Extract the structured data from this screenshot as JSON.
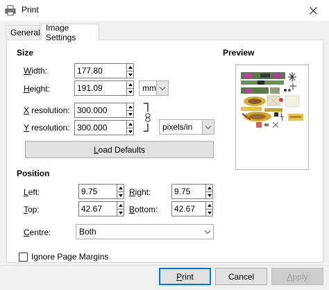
{
  "window": {
    "title": "Print",
    "icon": "printer-icon",
    "close_icon": "close-icon"
  },
  "tabs": [
    {
      "label": "General",
      "active": false
    },
    {
      "label": "Image Settings",
      "active": true
    }
  ],
  "size": {
    "heading": "Size",
    "width_label_u": "W",
    "width_label_rest": "idth:",
    "width_value": "177.80",
    "height_label_u": "H",
    "height_label_rest": "eight:",
    "height_value": "191.09",
    "unit": "mm",
    "xres_label_u": "X",
    "xres_label_rest": " resolution:",
    "xres_value": "300.000",
    "yres_label_u": "Y",
    "yres_label_rest": " resolution:",
    "yres_value": "300.000",
    "res_unit": "pixels/in",
    "load_defaults_u": "L",
    "load_defaults_rest": "oad Defaults"
  },
  "preview": {
    "heading": "Preview"
  },
  "position": {
    "heading": "Position",
    "left_label_u": "L",
    "left_label_rest": "eft:",
    "left_value": "9.75",
    "right_label_u": "R",
    "right_label_rest": "ight:",
    "right_value": "9.75",
    "top_label_u": "T",
    "top_label_rest": "op:",
    "top_value": "42.67",
    "bottom_label_u": "B",
    "bottom_label_rest": "ottom:",
    "bottom_value": "42.67",
    "centre_label_u": "C",
    "centre_label_rest": "entre:",
    "centre_value": "Both"
  },
  "ignore_margins": {
    "label": "Ignore Page Margins",
    "checked": false
  },
  "buttons": {
    "print_u": "P",
    "print_rest": "rint",
    "cancel": "Cancel",
    "apply_u": "A",
    "apply_rest": "pply"
  },
  "colors": {
    "accent": "#0078d7",
    "panel_bg": "#ffffff",
    "dialog_bg": "#f0f0f0"
  }
}
